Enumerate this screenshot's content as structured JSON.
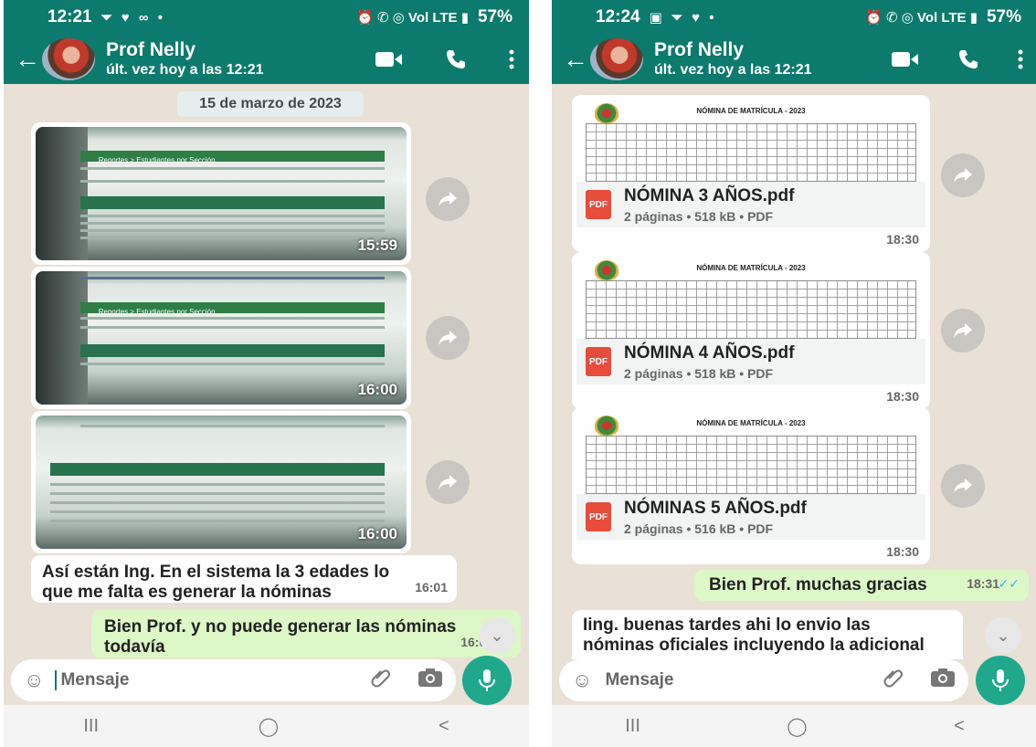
{
  "left": {
    "status": {
      "time": "12:21",
      "left_icons": "⏷ ♥ ∞ •",
      "right_icons": "⏰ ✆ ◎ Vol LTE ▮",
      "battery": "57%"
    },
    "contact": {
      "name": "Prof Nelly",
      "last_seen": "últ. vez hoy a las 12:21"
    },
    "date_chip": "15 de marzo de 2023",
    "screenshot": {
      "breadcrumb": "Reportes > Estudiantes por Sección",
      "section": "Estudiantes por Sección"
    },
    "images": [
      {
        "time": "15:59"
      },
      {
        "time": "16:00"
      },
      {
        "time": "16:00"
      }
    ],
    "incoming_message": {
      "line1": "Así están Ing. En el sistema la 3 edades lo",
      "line2": "que me falta es generar la nóminas",
      "time": "16:01"
    },
    "outgoing_message": {
      "line1": "Bien Prof. y no puede generar las nóminas",
      "line2": "todavía",
      "time": "16:04"
    },
    "input_placeholder": "Mensaje"
  },
  "right": {
    "status": {
      "time": "12:24",
      "left_icons": "▣ ⏷ ♥ •",
      "right_icons": "⏰ ✆ ◎ Vol LTE ▮",
      "battery": "57%"
    },
    "contact": {
      "name": "Prof Nelly",
      "last_seen": "últ. vez hoy a las 12:21"
    },
    "doc_title": "NÓMINA DE MATRÍCULA - 2023",
    "documents": [
      {
        "name": "NÓMINA 3 AÑOS.pdf",
        "meta": "2 páginas • 518 kB • PDF",
        "time": "18:30"
      },
      {
        "name": "NÓMINA 4 AÑOS.pdf",
        "meta": "2 páginas • 518 kB • PDF",
        "time": "18:30"
      },
      {
        "name": "NÓMINAS 5 AÑOS.pdf",
        "meta": "2 páginas • 516 kB • PDF",
        "time": "18:30"
      }
    ],
    "outgoing_message": {
      "text": "Bien Prof. muchas gracias",
      "time": "18:31"
    },
    "incoming_message": {
      "line1": "Iing. buenas tardes ahi lo envio las",
      "line2": "nóminas oficiales incluyendo la adicional"
    },
    "input_placeholder": "Mensaje"
  },
  "labels": {
    "pdf_badge": "PDF"
  },
  "nav": {
    "recents": "III",
    "home": "◯",
    "back": "<"
  },
  "colors": {
    "header": "#0c7a6c",
    "chat_bg": "#e9e1d6",
    "outgoing_bubble": "#dcf8c6",
    "mic": "#1fa88c",
    "pdf": "#e74c3c"
  }
}
